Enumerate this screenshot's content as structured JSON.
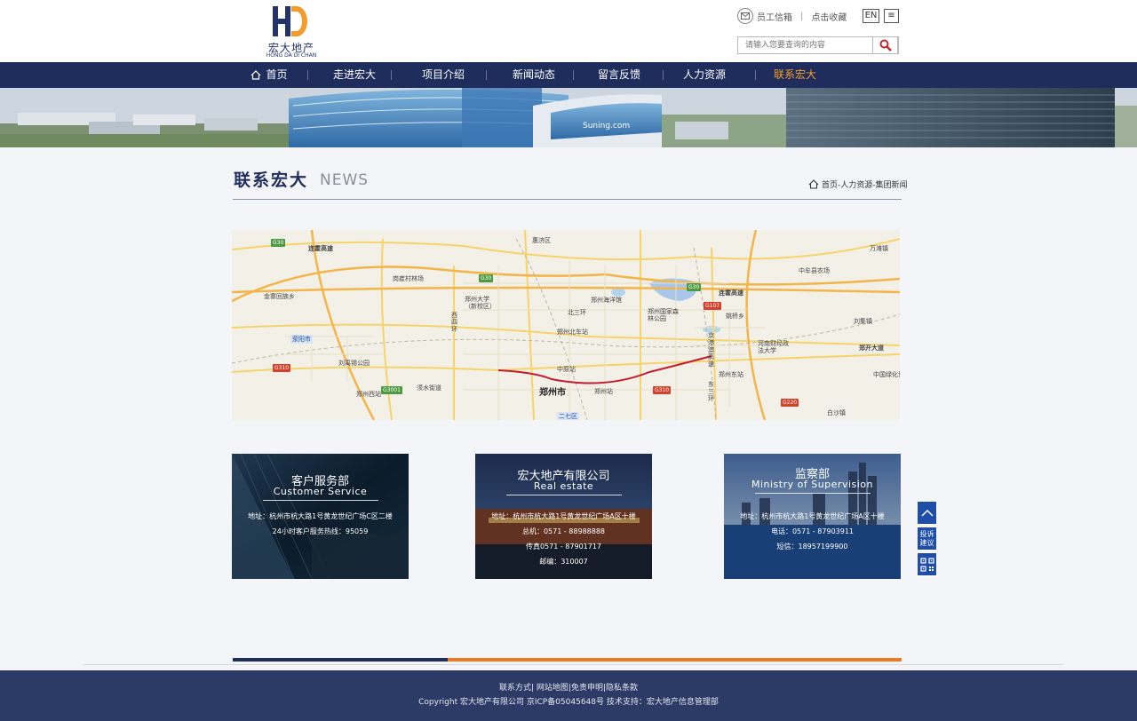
{
  "header": {
    "logo_letters": "HD",
    "logo_name": "宏大地产",
    "logo_pinyin": "HONG DA DI CHAN",
    "mail_label": "员工信箱",
    "bookmark_label": "点击收藏",
    "lang_label": "EN",
    "menu_glyph": "≡",
    "search_placeholder": "请输入您要查询的内容"
  },
  "nav": {
    "items": [
      {
        "label": "首页"
      },
      {
        "label": "走进宏大"
      },
      {
        "label": "项目介绍"
      },
      {
        "label": "新闻动态"
      },
      {
        "label": "留言反馈"
      },
      {
        "label": "人力资源"
      },
      {
        "label": "联系宏大"
      }
    ],
    "active_index": 6
  },
  "page": {
    "title": "联系宏大",
    "subtitle": "NEWS",
    "breadcrumb": "首页-人力资源-集团新闻"
  },
  "map": {
    "city_label": "郑州市",
    "labels": [
      "惠济区",
      "万滩镇",
      "连霍高速",
      "岗崔村林场",
      "郑州大学（新校区）",
      "郑州海洋馆",
      "中牟县农场",
      "金寨回族乡",
      "连霍高速",
      "郑州国家森林公园",
      "姚桥乡",
      "刘集镇",
      "荥阳市",
      "郑州北车站",
      "河南财经政法大学",
      "郑开大道",
      "刘禹锡公园",
      "中原站",
      "郑州东站",
      "中国绿化博览园",
      "郑州西站",
      "须水街道",
      "郑州站",
      "二七区",
      "白沙镇",
      "京港澳高速",
      "西四环",
      "北三环",
      "东三环"
    ],
    "badges": [
      "G30",
      "G30",
      "G30",
      "G107",
      "G310",
      "G310",
      "G3001",
      "G220"
    ]
  },
  "cards": [
    {
      "title": "客户服务部",
      "en": "Customer Service",
      "lines": [
        "地址：杭州市杭大路1号黄龙世纪广场C区二楼",
        "24小时客户服务热线：95059"
      ]
    },
    {
      "title": "宏大地产有限公司",
      "en": "Real estate",
      "lines": [
        "地址：杭州市杭大路1号黄龙世纪广场A区十楼",
        "总机：0571 - 88988888",
        "传真0571 - 87901717",
        "邮编：310007"
      ]
    },
    {
      "title": "监察部",
      "en": "Ministry of Supervision",
      "lines": [
        "地址：杭州市杭大路1号黄龙世纪广场A区十楼",
        "电话：0571 - 87903911",
        "短信：18957199900"
      ]
    }
  ],
  "float": {
    "complaint": "投诉建议"
  },
  "footer": {
    "links": "联系方式| 网站地图|免责申明|隐私条款",
    "copyright": "Copyright 宏大地产有限公司 京ICP备05045648号 技术支持：宏大地产信息管理部"
  },
  "colors": {
    "nav_bg": "#1f2d5c",
    "accent_orange": "#f39c2b",
    "footer_bg": "#2c3a66",
    "float_blue": "#1f4ea8"
  }
}
